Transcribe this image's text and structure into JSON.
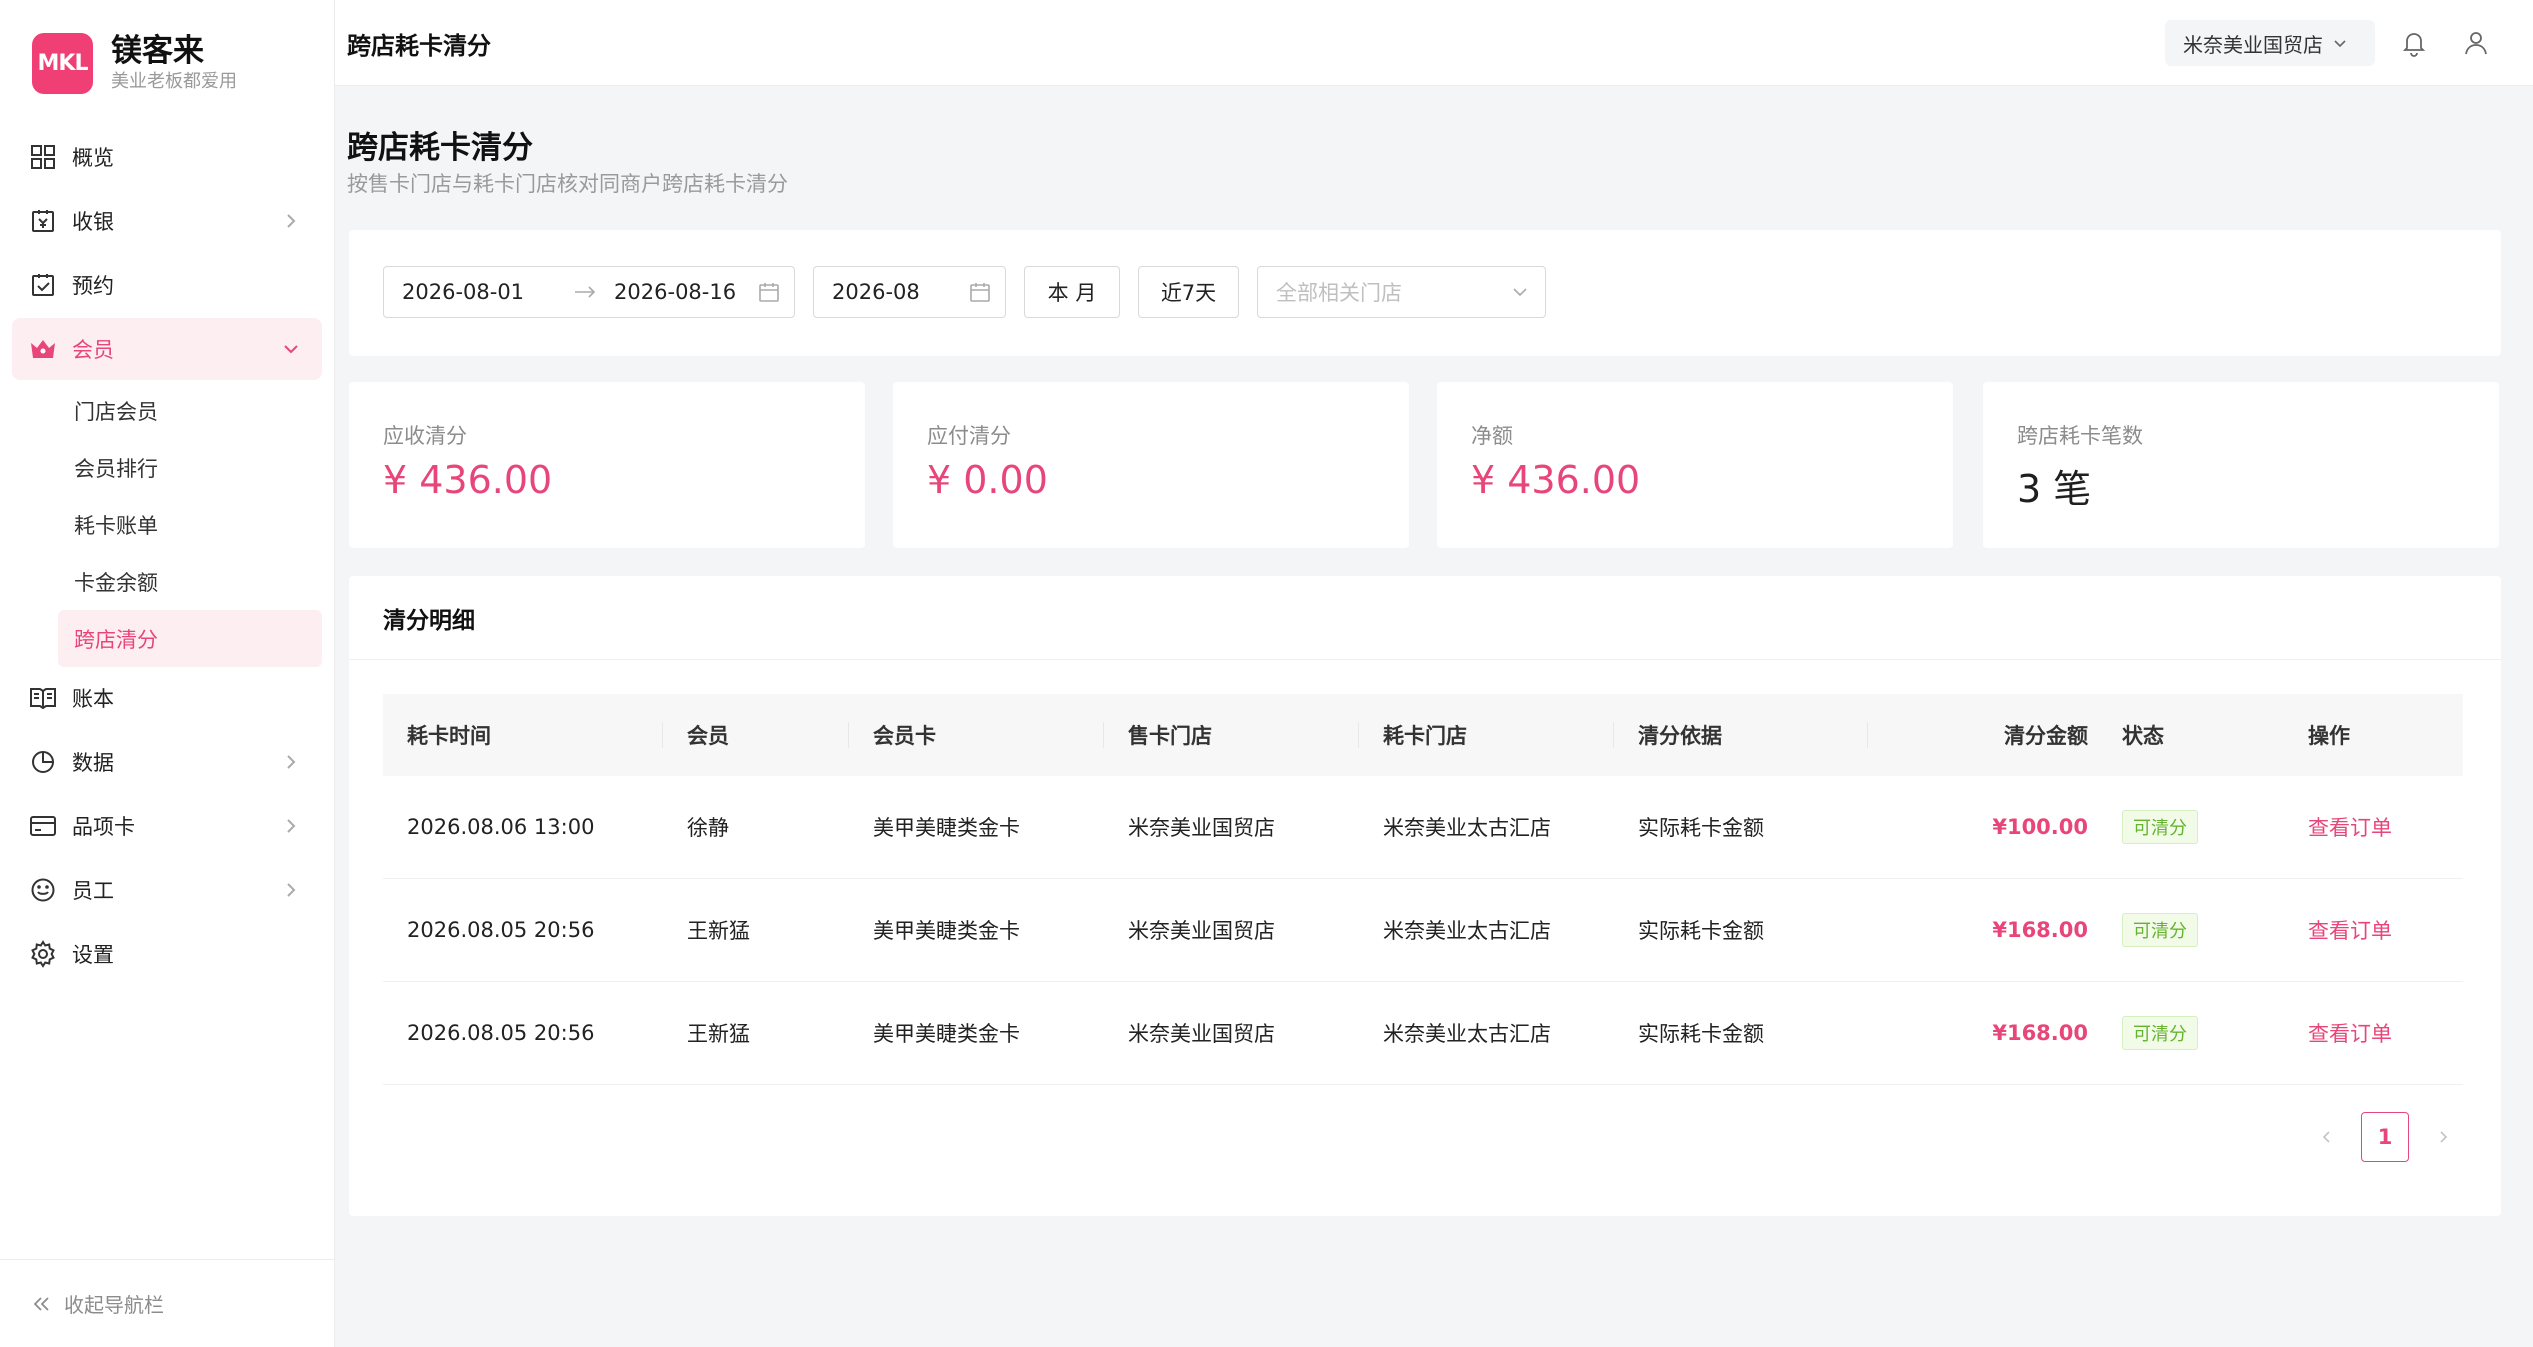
{
  "brand": {
    "logo_text": "MKL",
    "name": "镁客来",
    "slogan": "美业老板都爱用"
  },
  "sidebar": {
    "items": [
      {
        "label": "概览",
        "icon": "grid-icon"
      },
      {
        "label": "收银",
        "icon": "cashier-icon",
        "has_arrow": true
      },
      {
        "label": "预约",
        "icon": "calendar-check-icon"
      },
      {
        "label": "会员",
        "icon": "crown-icon",
        "has_arrow": true,
        "active": true
      },
      {
        "label": "账本",
        "icon": "book-icon"
      },
      {
        "label": "数据",
        "icon": "pie-chart-icon",
        "has_arrow": true
      },
      {
        "label": "品项卡",
        "icon": "card-icon",
        "has_arrow": true
      },
      {
        "label": "员工",
        "icon": "smile-icon",
        "has_arrow": true
      },
      {
        "label": "设置",
        "icon": "gear-icon"
      }
    ],
    "member_sub": [
      "门店会员",
      "会员排行",
      "耗卡账单",
      "卡金余额",
      "跨店清分"
    ],
    "active_sub": "跨店清分",
    "collapse_label": "收起导航栏"
  },
  "topbar": {
    "title": "跨店耗卡清分",
    "store": "米奈美业国贸店"
  },
  "page": {
    "title": "跨店耗卡清分",
    "subtitle": "按售卡门店与耗卡门店核对同商户跨店耗卡清分"
  },
  "filters": {
    "date_start": "2026-08-01",
    "date_end": "2026-08-16",
    "month": "2026-08",
    "btn_month": "本 月",
    "btn_7days": "近7天",
    "store_placeholder": "全部相关门店"
  },
  "stats": [
    {
      "label": "应收清分",
      "value": "¥ 436.00",
      "accent": true
    },
    {
      "label": "应付清分",
      "value": "¥ 0.00",
      "accent": true
    },
    {
      "label": "净额",
      "value": "¥ 436.00",
      "accent": true
    },
    {
      "label": "跨店耗卡笔数",
      "value": "3 笔",
      "accent": false
    }
  ],
  "detail": {
    "title": "清分明细",
    "columns": [
      "耗卡时间",
      "会员",
      "会员卡",
      "售卡门店",
      "耗卡门店",
      "清分依据",
      "清分金额",
      "状态",
      "操作"
    ],
    "rows": [
      {
        "time": "2026.08.06 13:00",
        "member": "徐静",
        "card": "美甲美睫类金卡",
        "sell_store": "米奈美业国贸店",
        "use_store": "米奈美业太古汇店",
        "basis": "实际耗卡金额",
        "amount": "¥100.00",
        "status": "可清分",
        "action": "查看订单"
      },
      {
        "time": "2026.08.05 20:56",
        "member": "王新猛",
        "card": "美甲美睫类金卡",
        "sell_store": "米奈美业国贸店",
        "use_store": "米奈美业太古汇店",
        "basis": "实际耗卡金额",
        "amount": "¥168.00",
        "status": "可清分",
        "action": "查看订单"
      },
      {
        "time": "2026.08.05 20:56",
        "member": "王新猛",
        "card": "美甲美睫类金卡",
        "sell_store": "米奈美业国贸店",
        "use_store": "米奈美业太古汇店",
        "basis": "实际耗卡金额",
        "amount": "¥168.00",
        "status": "可清分",
        "action": "查看订单"
      }
    ],
    "pagination": {
      "current_page": "1"
    }
  },
  "colors": {
    "accent": "#e8467a",
    "status_green": "#65b330"
  }
}
